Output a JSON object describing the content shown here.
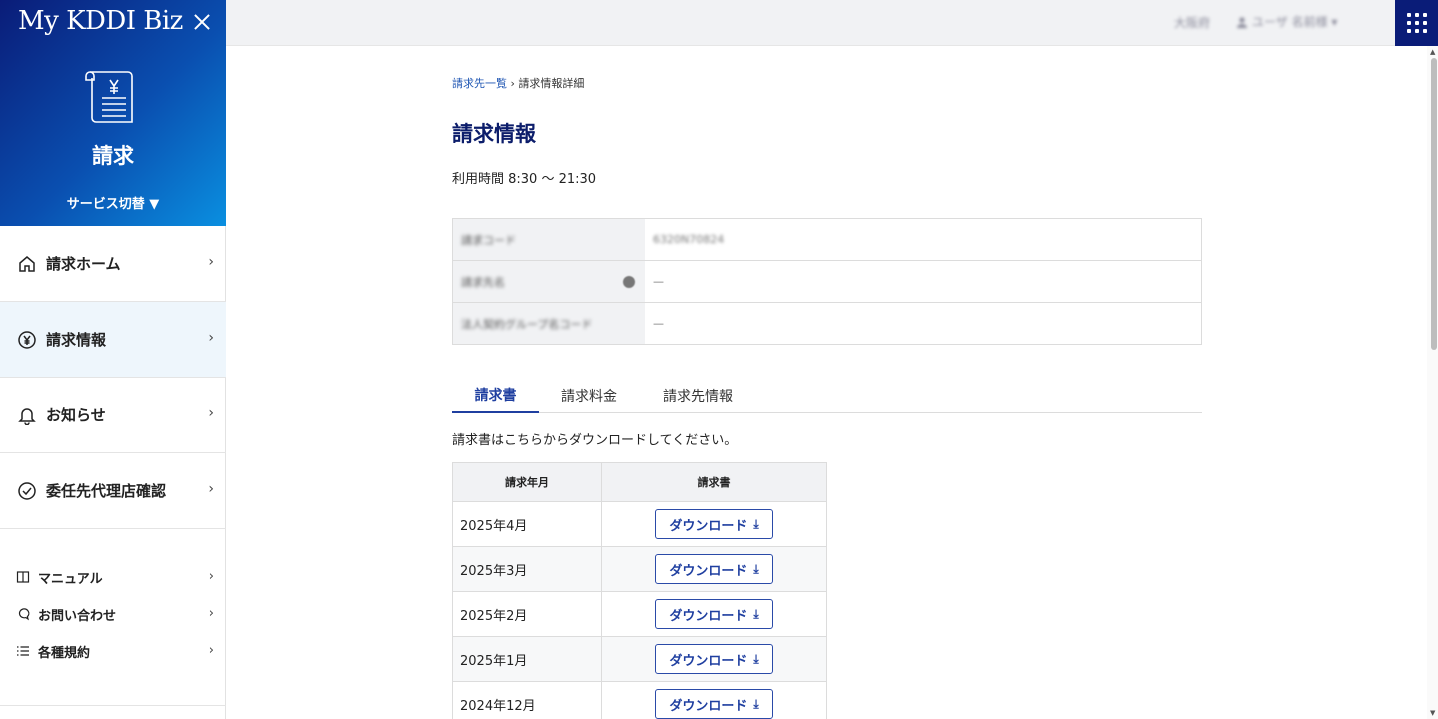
{
  "sidebar": {
    "brand": "My KDDI Biz",
    "title": "請求",
    "service_switch": "サービス切替 ▼",
    "nav": [
      {
        "label": "請求ホーム",
        "icon": "home-icon"
      },
      {
        "label": "請求情報",
        "icon": "yen-circle-icon",
        "active": true
      },
      {
        "label": "お知らせ",
        "icon": "bell-icon"
      },
      {
        "label": "委任先代理店確認",
        "icon": "check-circle-icon"
      }
    ],
    "sub": [
      {
        "label": "マニュアル",
        "icon": "book-icon"
      },
      {
        "label": "お問い合わせ",
        "icon": "chat-icon"
      },
      {
        "label": "各種規約",
        "icon": "list-icon"
      }
    ],
    "chevron": "›"
  },
  "topbar": {
    "company": "大阪府",
    "user": "ユーザ 名前様 ▾"
  },
  "breadcrumb": {
    "parent": "請求先一覧",
    "separator": " › ",
    "current": "請求情報詳細"
  },
  "page_title": "請求情報",
  "hours": "利用時間 8:30 〜 21:30",
  "info_rows": [
    {
      "key": "請求コード",
      "value": "6320N70824"
    },
    {
      "key": "請求先名",
      "value": "—"
    },
    {
      "key": "法人契約グループ名コード",
      "value": "—"
    }
  ],
  "tabs": [
    "請求書",
    "請求料金",
    "請求先情報"
  ],
  "tab_desc": "請求書はこちらからダウンロードしてください。",
  "invoice_table": {
    "headers": [
      "請求年月",
      "請求書"
    ],
    "button_label": "ダウンロード",
    "rows": [
      "2025年4月",
      "2025年3月",
      "2025年2月",
      "2025年1月",
      "2024年12月"
    ]
  },
  "colors": {
    "brand_navy": "#0a1c78",
    "accent_blue": "#1f3fa0",
    "active_bg": "#eef6fc"
  }
}
